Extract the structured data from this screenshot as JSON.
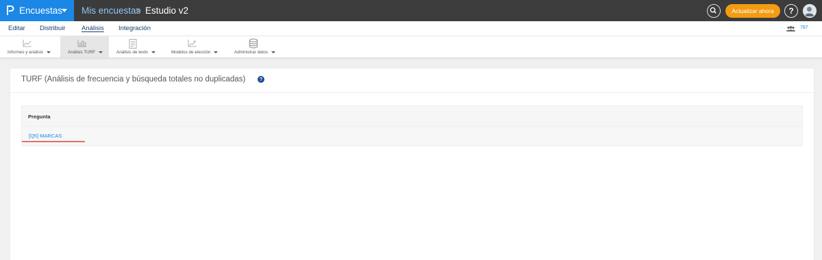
{
  "header": {
    "brand_label": "Encuestas",
    "breadcrumb_root": "Mis encuestas",
    "breadcrumb_separator": ">",
    "breadcrumb_current": "Estudio v2",
    "upgrade_label": "Actualizar ahora",
    "help_label": "?",
    "brand_color": "#1b87e6",
    "upgrade_color": "#f39c12"
  },
  "menu": {
    "items": [
      {
        "label": "Editar"
      },
      {
        "label": "Distribuir"
      },
      {
        "label": "Análisis",
        "active": true
      },
      {
        "label": "Integración"
      }
    ],
    "users_count": "787"
  },
  "toolbar": {
    "tools": [
      {
        "label": "Informes y análisis",
        "icon": "chart-line-icon"
      },
      {
        "label": "Análisis TURF",
        "icon": "chart-bar-icon",
        "selected": true
      },
      {
        "label": "Análisis de texto",
        "icon": "text-document-icon"
      },
      {
        "label": "Modelos de elección",
        "icon": "chart-model-icon"
      },
      {
        "label": "Administrar datos",
        "icon": "database-icon"
      }
    ]
  },
  "panel": {
    "title": "TURF (Análisis de frecuencia y búsqueda totales no duplicadas)",
    "info_label": "?",
    "table": {
      "header": "Pregunta",
      "rows": [
        {
          "label": "[Q5] MARCAS"
        }
      ]
    }
  }
}
